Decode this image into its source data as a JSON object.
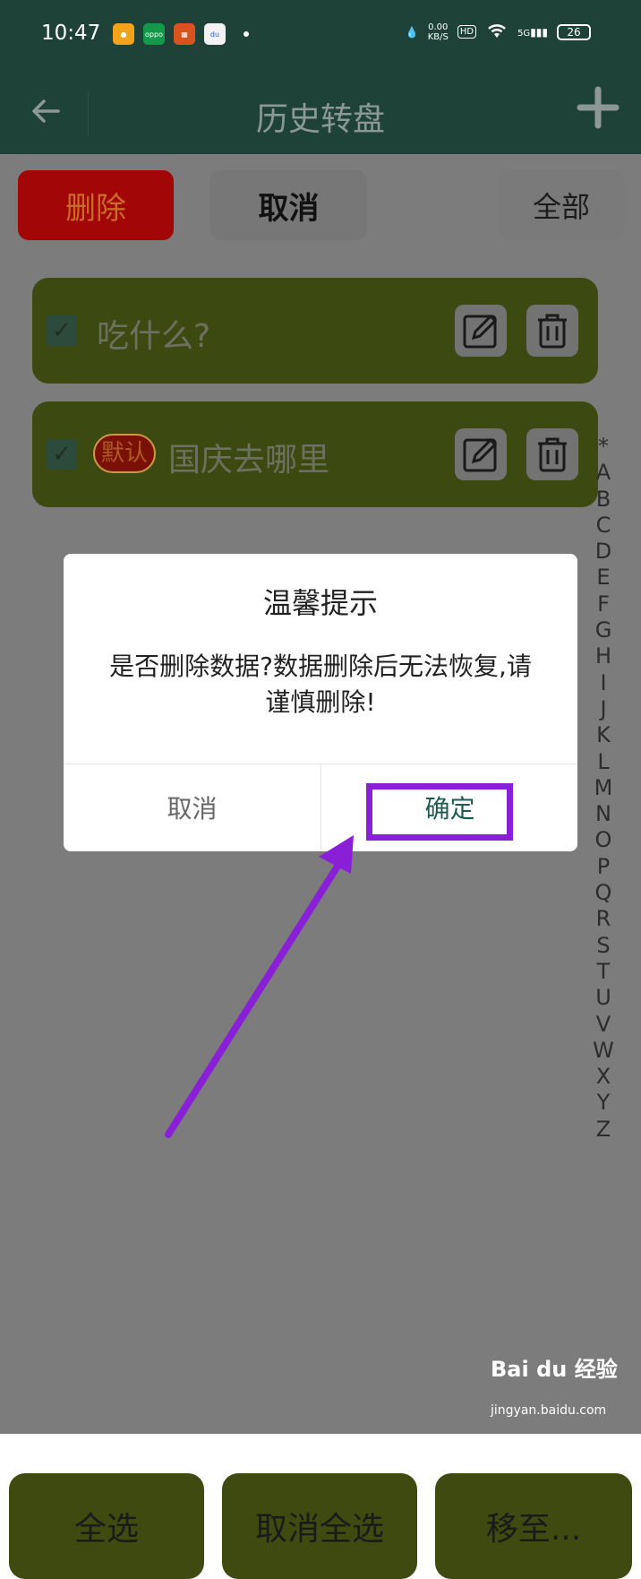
{
  "status_bar": {
    "time": "10:47",
    "net_speed": "0.00",
    "net_unit": "KB/S",
    "hd": "HD",
    "signal": "5G",
    "battery": "26"
  },
  "header": {
    "title": "历史转盘"
  },
  "top_actions": {
    "delete": "删除",
    "cancel": "取消",
    "all": "全部"
  },
  "items": [
    {
      "label": "吃什么?",
      "checked": true,
      "badge": ""
    },
    {
      "label": "国庆去哪里",
      "checked": true,
      "badge": "默认"
    }
  ],
  "index_letters": [
    "*",
    "A",
    "B",
    "C",
    "D",
    "E",
    "F",
    "G",
    "H",
    "I",
    "J",
    "K",
    "L",
    "M",
    "N",
    "O",
    "P",
    "Q",
    "R",
    "S",
    "T",
    "U",
    "V",
    "W",
    "X",
    "Y",
    "Z"
  ],
  "dialog": {
    "title": "温馨提示",
    "message": "是否删除数据?数据删除后无法恢复,请谨慎删除!",
    "cancel": "取消",
    "confirm": "确定"
  },
  "bottom_actions": {
    "select_all": "全选",
    "deselect_all": "取消全选",
    "move": "移至..."
  },
  "watermark": {
    "brand": "Bai du 经验",
    "url": "jingyan.baidu.com"
  },
  "colors": {
    "header_bg": "#1f4238",
    "item_bg": "#3c4a12",
    "delete_bg": "#a30606",
    "highlight": "#8a1fd8",
    "confirm_text": "#1f5a4e"
  }
}
